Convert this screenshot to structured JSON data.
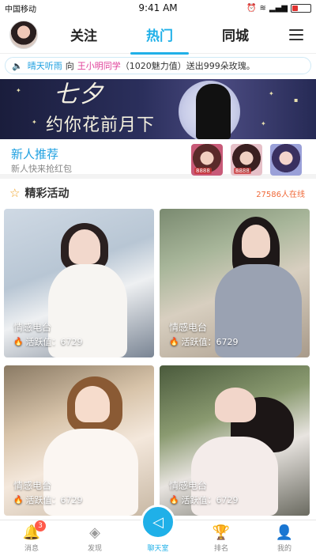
{
  "status_bar": {
    "carrier": "中国移动",
    "time": "9:41 AM"
  },
  "header": {
    "tabs": [
      {
        "label": "关注"
      },
      {
        "label": "热门"
      },
      {
        "label": "同城"
      }
    ],
    "active_tab": "热门"
  },
  "marquee": {
    "sender": "晴天听雨",
    "to": "向",
    "receiver": "王小明同学",
    "detail": "（1020魅力值）送出999朵玫瑰。"
  },
  "banner": {
    "big_text": "七夕",
    "title": "约你花前月下"
  },
  "recommend": {
    "title": "新人推荐",
    "subtitle": "新人快来抢红包",
    "thumb_tags": [
      "8888",
      "8888",
      ""
    ]
  },
  "activity": {
    "title": "精彩活动",
    "online": "27586人在线"
  },
  "cards": [
    {
      "title": "情感电台",
      "meta": "活跃值：6729"
    },
    {
      "title": "情感电台",
      "meta": "活跃值：6729"
    },
    {
      "title": "情感电台",
      "meta": "活跃值：6729"
    },
    {
      "title": "情感电台",
      "meta": "活跃值：6729"
    }
  ],
  "bottom_nav": {
    "items": [
      {
        "label": "消息",
        "badge": "3"
      },
      {
        "label": "发现"
      },
      {
        "label": "聊天室"
      },
      {
        "label": "排名"
      },
      {
        "label": "我的"
      }
    ]
  },
  "colors": {
    "accent": "#1fb0e8",
    "pink": "#e0409a",
    "orange": "#f06a3a"
  }
}
